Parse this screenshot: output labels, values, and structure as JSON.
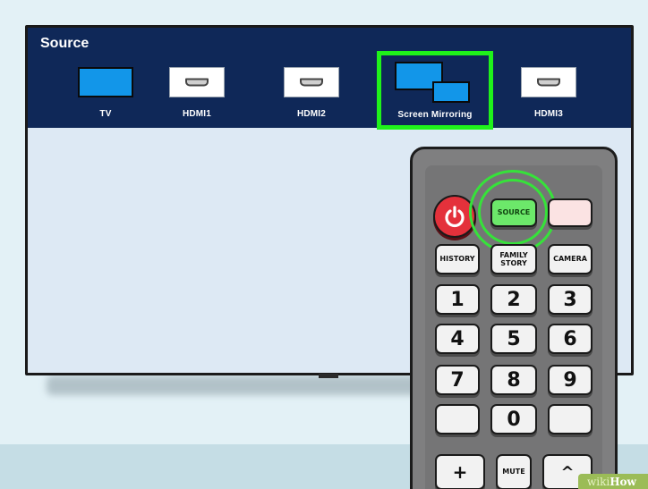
{
  "source_menu": {
    "title": "Source",
    "items": [
      {
        "label": "TV",
        "tile": "blue"
      },
      {
        "label": "HDMI1",
        "tile": "white",
        "icon": "hdmi-port-icon"
      },
      {
        "label": "HDMI2",
        "tile": "white",
        "icon": "hdmi-port-icon"
      },
      {
        "label": "Screen Mirroring",
        "tile": "blue-dual",
        "highlighted": true
      },
      {
        "label": "HDMI3",
        "tile": "white",
        "icon": "hdmi-port-icon"
      }
    ],
    "highlight_color": "#1ff21a"
  },
  "remote": {
    "power_icon": "power-icon",
    "source_label": "SOURCE",
    "history_label": "HISTORY",
    "family_story_line1": "FAMILY",
    "family_story_line2": "STORY",
    "camera_label": "CAMERA",
    "digits": [
      "1",
      "2",
      "3",
      "4",
      "5",
      "6",
      "7",
      "8",
      "9",
      "0"
    ],
    "mute_label": "MUTE",
    "plus_label": "+",
    "up_label": "^",
    "source_color": "#6ce86a",
    "power_color": "#e4313b"
  },
  "watermark": {
    "wiki": "wiki",
    "how": "How"
  }
}
